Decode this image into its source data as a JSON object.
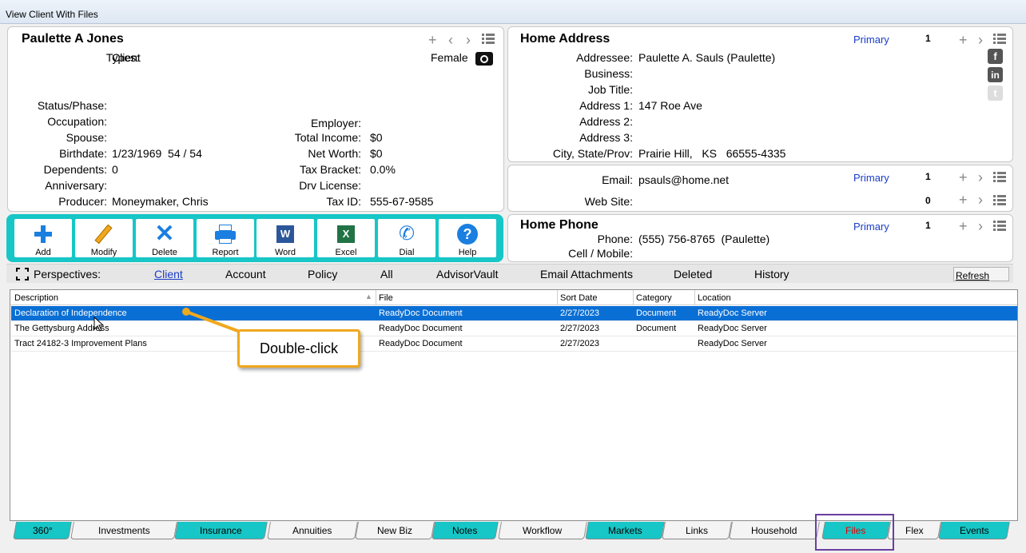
{
  "window": {
    "title": "View Client With Files"
  },
  "client": {
    "name": "Paulette A Jones",
    "types_label": "Types:",
    "types_value": "Client",
    "gender": "Female",
    "fields_left": [
      {
        "label": "Status/Phase:",
        "value": ""
      },
      {
        "label": "Occupation:",
        "value": ""
      },
      {
        "label": "Spouse:",
        "value": ""
      },
      {
        "label": "Birthdate:",
        "value": "1/23/1969  54 / 54"
      },
      {
        "label": "Dependents:",
        "value": "0"
      },
      {
        "label": "Anniversary:",
        "value": ""
      },
      {
        "label": "Producer:",
        "value": "Moneymaker, Chris"
      }
    ],
    "fields_right": [
      {
        "label": "Employer:",
        "value": ""
      },
      {
        "label": "Total Income:",
        "value": "$0"
      },
      {
        "label": "Net Worth:",
        "value": "$0"
      },
      {
        "label": "Tax Bracket:",
        "value": "0.0%"
      },
      {
        "label": "Drv License:",
        "value": ""
      },
      {
        "label": "Tax ID:",
        "value": "555-67-9585"
      }
    ]
  },
  "address": {
    "title": "Home Address",
    "primary": "Primary",
    "count": "1",
    "fields": [
      {
        "label": "Addressee:",
        "value": "Paulette A. Sauls (Paulette)"
      },
      {
        "label": "Business:",
        "value": ""
      },
      {
        "label": "Job Title:",
        "value": ""
      },
      {
        "label": "Address 1:",
        "value": "147 Roe Ave"
      },
      {
        "label": "Address 2:",
        "value": ""
      },
      {
        "label": "Address 3:",
        "value": ""
      },
      {
        "label": "City, State/Prov:",
        "value": "Prairie Hill,   KS   66555-4335"
      }
    ]
  },
  "email": {
    "email_label": "Email:",
    "email_value": "psauls@home.net",
    "primary": "Primary",
    "email_count": "1",
    "web_label": "Web Site:",
    "web_value": "",
    "web_count": "0"
  },
  "phone": {
    "title": "Home Phone",
    "primary": "Primary",
    "count": "1",
    "phone_label": "Phone:",
    "phone_value": "(555) 756-8765  (Paulette)",
    "cell_label": "Cell / Mobile:",
    "cell_value": ""
  },
  "toolbar": {
    "buttons": [
      {
        "label": "Add",
        "icon": "plus-icon"
      },
      {
        "label": "Modify",
        "icon": "pencil-icon"
      },
      {
        "label": "Delete",
        "icon": "x-icon"
      },
      {
        "label": "Report",
        "icon": "printer-icon"
      },
      {
        "label": "Word",
        "icon": "word-icon"
      },
      {
        "label": "Excel",
        "icon": "excel-icon"
      },
      {
        "label": "Dial",
        "icon": "phone-icon"
      },
      {
        "label": "Help",
        "icon": "help-icon"
      }
    ]
  },
  "perspectives": {
    "label": "Perspectives:",
    "items": [
      "Client",
      "Account",
      "Policy",
      "All",
      "AdvisorVault",
      "Email Attachments",
      "Deleted",
      "History"
    ],
    "refresh": "Refresh"
  },
  "grid": {
    "columns": [
      "Description",
      "File",
      "Sort Date",
      "Category",
      "Location"
    ],
    "rows": [
      [
        "Declaration of Independence",
        "ReadyDoc Document",
        "2/27/2023",
        "Document",
        "ReadyDoc Server"
      ],
      [
        "The Gettysburg Address",
        "ReadyDoc Document",
        "2/27/2023",
        "Document",
        "ReadyDoc Server"
      ],
      [
        "Tract 24182-3 Improvement Plans",
        "ReadyDoc Document",
        "2/27/2023",
        "",
        "ReadyDoc Server"
      ]
    ]
  },
  "callout": {
    "text": "Double-click"
  },
  "tabs": [
    "360°",
    "Investments",
    "Insurance",
    "Annuities",
    "New Biz",
    "Notes",
    "Workflow",
    "Markets",
    "Links",
    "Household",
    "Files",
    "Flex",
    "Events"
  ],
  "colors": {
    "accent": "#17c6c6",
    "selection": "#0a6fd4",
    "primary_link": "#1a3cc8",
    "callout_border": "#f0a81e",
    "files_tab_text": "#e00000",
    "highlight_box": "#6a3fa0"
  }
}
